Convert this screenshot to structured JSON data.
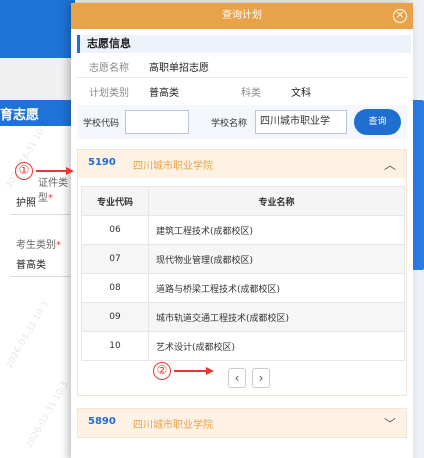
{
  "background": {
    "header": "育志愿",
    "fields": [
      {
        "label": "证件类型",
        "required": true,
        "value": "护照"
      },
      {
        "label": "考生类别",
        "required": true,
        "value": "普高类"
      }
    ],
    "watermark_text": "2026-03-31 10:3"
  },
  "modal": {
    "title": "查询计划",
    "close_symbol": "×",
    "section_title": "志愿信息",
    "info": {
      "wish_name_label": "志愿名称",
      "wish_name_value": "高职单招志愿",
      "plan_type_label": "计划类别",
      "plan_type_value": "普高类",
      "subject_label": "科类",
      "subject_value": "文科"
    },
    "search": {
      "code_label": "学校代码",
      "code_value": "",
      "name_label": "学校名称",
      "name_value": "四川城市职业学",
      "button": "查询"
    },
    "results": [
      {
        "code": "5190",
        "name": "四川城市职业学院",
        "expanded": true,
        "chevron": "︿",
        "columns": [
          "专业代码",
          "专业名称"
        ],
        "rows": [
          {
            "code": "06",
            "name": "建筑工程技术(成都校区)"
          },
          {
            "code": "07",
            "name": "现代物业管理(成都校区)"
          },
          {
            "code": "08",
            "name": "道路与桥梁工程技术(成都校区)"
          },
          {
            "code": "09",
            "name": "城市轨道交通工程技术(成都校区)"
          },
          {
            "code": "10",
            "name": "艺术设计(成都校区)"
          }
        ],
        "pager": {
          "prev": "‹",
          "next": "›"
        }
      },
      {
        "code": "5890",
        "name": "四川城市职业学院",
        "expanded": false,
        "chevron": "﹀"
      }
    ]
  },
  "annotations": {
    "one": "①",
    "two": "②"
  },
  "colors": {
    "accent_orange": "#e8a24a",
    "primary_blue": "#1f6fd1",
    "annotation_red": "#e53935"
  }
}
